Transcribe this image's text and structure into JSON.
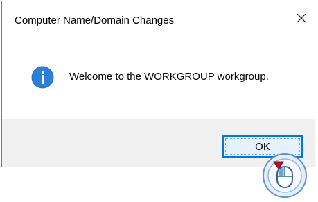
{
  "dialog": {
    "title": "Computer Name/Domain Changes",
    "message": "Welcome to the WORKGROUP workgroup.",
    "ok_label": "OK",
    "icons": {
      "close": "close-icon",
      "info": "info-icon",
      "cursor": "mouse-click-icon"
    },
    "colors": {
      "accent": "#0078d7",
      "info_icon": "#1a6fc9",
      "footer_bg": "#f0f0f0",
      "ok_bg": "#e5f1fb",
      "cursor_arrow": "#b5121b"
    }
  }
}
